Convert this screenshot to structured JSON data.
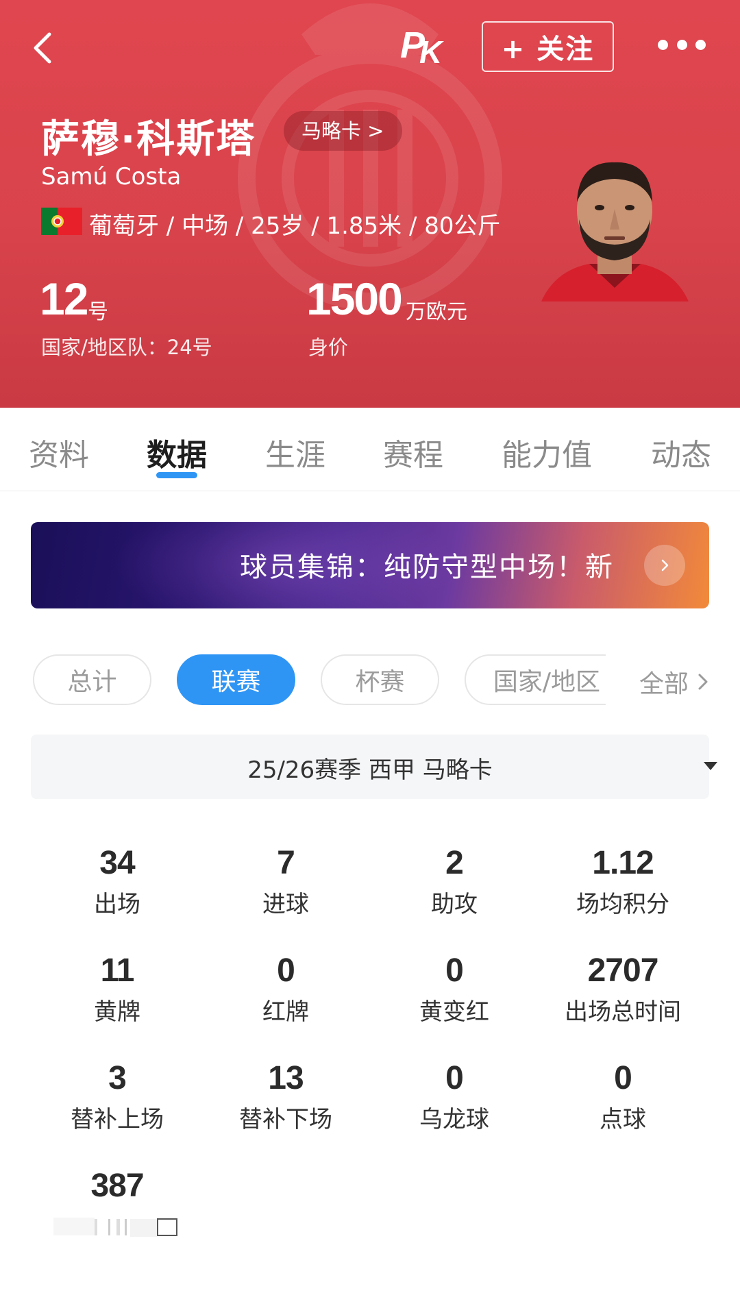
{
  "header": {
    "back_icon": "back-arrow-icon",
    "logo_text": "PK",
    "follow_label": "+ 关注",
    "more_icon": "more-dots-icon",
    "name_cn": "萨穆·科斯塔",
    "club_badge": "马略卡 >",
    "name_en": "Samú Costa",
    "flag": "portugal-flag",
    "info_line": "葡萄牙 / 中场 / 25岁 / 1.85米 / 80公斤",
    "shirt_number": "12",
    "shirt_number_unit": "号",
    "national_team_number": "国家/地区队：24号",
    "market_value": "1500",
    "market_value_unit": "万欧元",
    "market_value_label": "身价",
    "colors": {
      "primary": "#d9434b",
      "accent": "#2f95f5"
    }
  },
  "tabs": [
    {
      "label": "资料",
      "active": false
    },
    {
      "label": "数据",
      "active": true
    },
    {
      "label": "生涯",
      "active": false
    },
    {
      "label": "赛程",
      "active": false
    },
    {
      "label": "能力值",
      "active": false
    },
    {
      "label": "动态",
      "active": false
    }
  ],
  "banner": {
    "text": "球员集锦：纯防守型中场！新",
    "arrow_icon": "chevron-right-icon"
  },
  "filters": {
    "chips": [
      {
        "label": "总计",
        "active": false
      },
      {
        "label": "联赛",
        "active": true
      },
      {
        "label": "杯赛",
        "active": false
      },
      {
        "label": "国家/地区",
        "active": false
      }
    ],
    "all_label": "全部"
  },
  "season": {
    "label": "25/26赛季 西甲 马略卡"
  },
  "stats": [
    {
      "value": "34",
      "label": "出场"
    },
    {
      "value": "7",
      "label": "进球"
    },
    {
      "value": "2",
      "label": "助攻"
    },
    {
      "value": "1.12",
      "label": "场均积分"
    },
    {
      "value": "11",
      "label": "黄牌"
    },
    {
      "value": "0",
      "label": "红牌"
    },
    {
      "value": "0",
      "label": "黄变红"
    },
    {
      "value": "2707",
      "label": "出场总时间"
    },
    {
      "value": "3",
      "label": "替补上场"
    },
    {
      "value": "13",
      "label": "替补下场"
    },
    {
      "value": "0",
      "label": "乌龙球"
    },
    {
      "value": "0",
      "label": "点球"
    },
    {
      "value": "387",
      "label": ""
    }
  ]
}
